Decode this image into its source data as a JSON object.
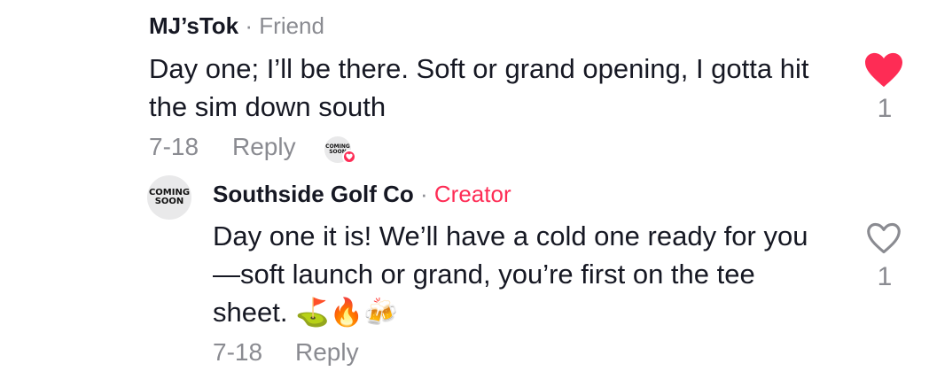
{
  "comment": {
    "author": "MJ’sTok",
    "separator": "·",
    "tag": "Friend",
    "text": "Day one; I’ll be there. Soft or grand opening, I gotta hit the sim down south",
    "date": "7-18",
    "reply_label": "Reply",
    "creator_avatar_text": "COMING SOON",
    "like_count": "1",
    "liked": true,
    "like_color": "#fe2c55"
  },
  "reply": {
    "avatar_text": "COMING SOON",
    "author": "Southside Golf Co",
    "separator": "·",
    "tag": "Creator",
    "tag_color": "#fe2c55",
    "text": "Day one it is! We’ll have a cold one ready for you—soft launch or grand, you’re first on the tee sheet. ⛳🔥🍻",
    "date": "7-18",
    "reply_label": "Reply",
    "like_count": "1",
    "liked": false
  }
}
